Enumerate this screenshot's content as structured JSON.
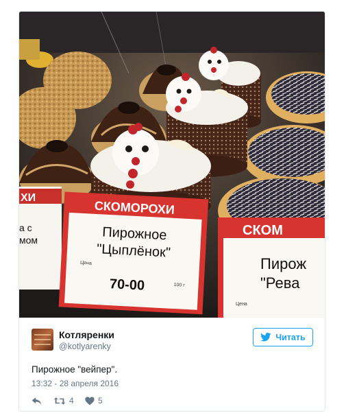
{
  "photo": {
    "sign_brand": "СКОМОРОХИ",
    "sign_product_line1": "Пирожное",
    "sign_product_line2": "\"Цыплёнок\"",
    "sign_price_label": "Цена",
    "sign_price": "70-00",
    "sign_weight": "100 г",
    "sign_left_partial_brand": "ХИ",
    "sign_left_partial_line1": "а с",
    "sign_left_partial_line2": "мом",
    "sign_right_brand": "СКОМ",
    "sign_right_line1": "Пирож",
    "sign_right_line2": "\"Рева",
    "sign_right_price_label": "Цена"
  },
  "author": {
    "display_name": "Котляренки",
    "handle": "@kotlyarenky"
  },
  "follow_button": {
    "label": "Читать"
  },
  "tweet": {
    "text": "Пирожное \"вейпер\".",
    "timestamp": "13:32 - 28 апреля 2016"
  },
  "actions": {
    "retweet_count": "4",
    "like_count": "5"
  },
  "colors": {
    "accent": "#1da1f2",
    "sign_red": "#c8302c",
    "muted": "#657786"
  }
}
